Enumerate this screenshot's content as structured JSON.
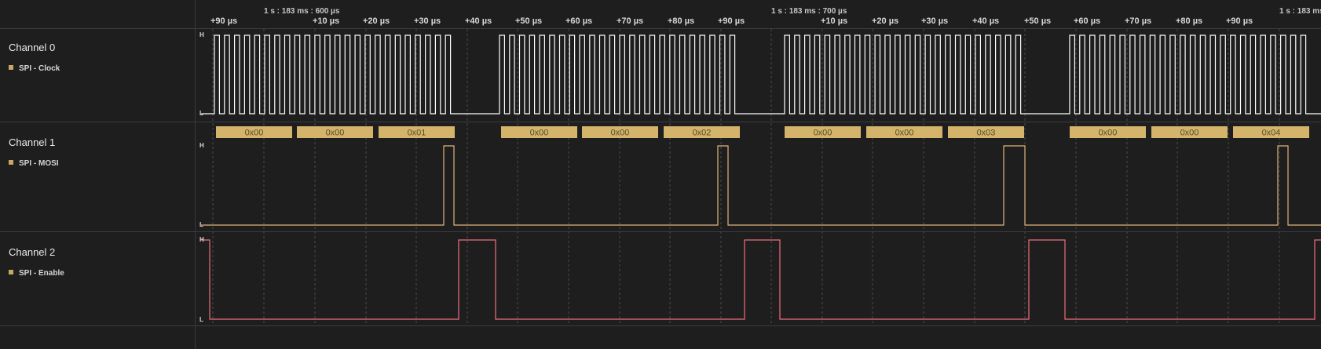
{
  "ruler": {
    "major": [
      "1 s : 183 ms : 600 µs",
      "1 s : 183 ms : 700 µs",
      "1 s : 183 ms"
    ],
    "ticks": [
      "+90 µs",
      "+10 µs",
      "+20 µs",
      "+30 µs",
      "+40 µs",
      "+50 µs",
      "+60 µs",
      "+70 µs",
      "+80 µs",
      "+90 µs",
      "+10 µs",
      "+20 µs",
      "+30 µs",
      "+40 µs",
      "+50 µs",
      "+60 µs",
      "+70 µs",
      "+80 µs",
      "+90 µs"
    ]
  },
  "channels": [
    {
      "name": "Channel 0",
      "analyzer": "SPI - Clock",
      "color": "#ffffff"
    },
    {
      "name": "Channel 1",
      "analyzer": "SPI - MOSI",
      "color": "#e0b47a"
    },
    {
      "name": "Channel 2",
      "analyzer": "SPI - Enable",
      "color": "#f06d7c"
    }
  ],
  "levels": {
    "high": "H",
    "low": "L"
  },
  "decoded_bytes": [
    "0x00",
    "0x00",
    "0x01",
    "0x00",
    "0x00",
    "0x02",
    "0x00",
    "0x00",
    "0x03",
    "0x00",
    "0x00",
    "0x04"
  ],
  "colors": {
    "background": "#1e1e1f",
    "annotation": "#d4b46a",
    "annotation_text": "#5a4a28",
    "grid": "#4a4a4d"
  }
}
